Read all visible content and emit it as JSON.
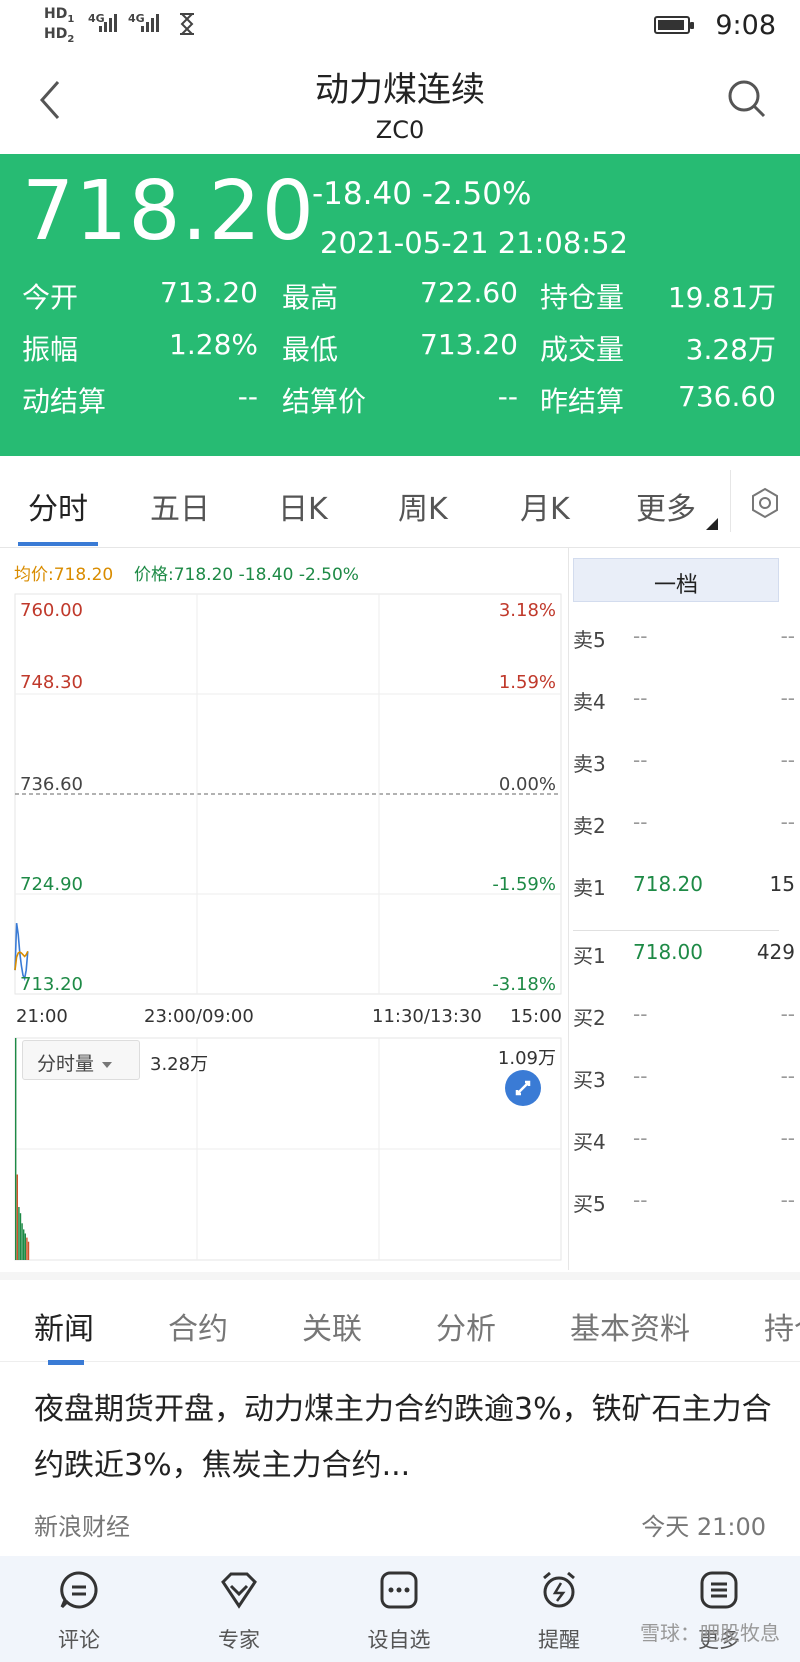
{
  "status_bar": {
    "net1": "HD",
    "net1_sub": "1",
    "net2": "HD",
    "net2_sub": "2",
    "sig1": "4G",
    "sig2": "4G",
    "time": "9:08"
  },
  "header": {
    "title": "动力煤连续",
    "code": "ZC0",
    "back_icon": "chevron-left-icon",
    "search_icon": "search-icon"
  },
  "quote": {
    "bg_color": "#27bb73",
    "price": "718.20",
    "change": "-18.40 -2.50%",
    "datetime": "2021-05-21 21:08:52",
    "fields": [
      {
        "label": "今开",
        "value": "713.20"
      },
      {
        "label": "最高",
        "value": "722.60"
      },
      {
        "label": "持仓量",
        "value": "19.81万"
      },
      {
        "label": "振幅",
        "value": "1.28%"
      },
      {
        "label": "最低",
        "value": "713.20"
      },
      {
        "label": "成交量",
        "value": "3.28万"
      },
      {
        "label": "动结算",
        "value": "--"
      },
      {
        "label": "结算价",
        "value": "--"
      },
      {
        "label": "昨结算",
        "value": "736.60"
      }
    ]
  },
  "chart_tabs": {
    "items": [
      "分时",
      "五日",
      "日K",
      "周K",
      "月K",
      "更多"
    ],
    "active": "分时",
    "settings_icon": "hexagon-settings-icon"
  },
  "chart": {
    "legend_avg": "均价:718.20",
    "legend_price": "价格:718.20 -18.40 -2.50%",
    "avg_color": "#d98c00",
    "price_color": "#1e8a46",
    "y_labels": [
      "760.00",
      "748.30",
      "736.60",
      "724.90",
      "713.20"
    ],
    "pct_labels": [
      "3.18%",
      "1.59%",
      "0.00%",
      "-1.59%",
      "-3.18%"
    ],
    "x_labels": [
      "21:00",
      "23:00/09:00",
      "11:30/13:30",
      "15:00"
    ],
    "volume_button": "分时量",
    "volume_total": "3.28万",
    "volume_max": "1.09万",
    "expand_icon": "expand-icon"
  },
  "chart_data": {
    "type": "line",
    "title": "",
    "x": [
      "21:00",
      "21:01",
      "21:02",
      "21:03",
      "21:04",
      "21:05",
      "21:06",
      "21:07",
      "21:08"
    ],
    "series": [
      {
        "name": "价格",
        "values": [
          716.0,
          721.5,
          720.2,
          718.0,
          716.5,
          715.4,
          715.0,
          716.0,
          718.2
        ]
      },
      {
        "name": "均价",
        "values": [
          716.0,
          717.5,
          718.0,
          718.1,
          718.0,
          717.8,
          717.6,
          717.8,
          718.2
        ]
      }
    ],
    "volume": [
      10900,
      4200,
      2600,
      2300,
      1800,
      1500,
      1300,
      1100,
      900
    ],
    "ylim": [
      713.2,
      760.0
    ],
    "volume_max": 10900,
    "xlabel": "",
    "ylabel": ""
  },
  "order_book": {
    "header": "一档",
    "sell": [
      {
        "label": "卖5",
        "price": "--",
        "vol": "--"
      },
      {
        "label": "卖4",
        "price": "--",
        "vol": "--"
      },
      {
        "label": "卖3",
        "price": "--",
        "vol": "--"
      },
      {
        "label": "卖2",
        "price": "--",
        "vol": "--"
      },
      {
        "label": "卖1",
        "price": "718.20",
        "vol": "15"
      }
    ],
    "buy": [
      {
        "label": "买1",
        "price": "718.00",
        "vol": "429"
      },
      {
        "label": "买2",
        "price": "--",
        "vol": "--"
      },
      {
        "label": "买3",
        "price": "--",
        "vol": "--"
      },
      {
        "label": "买4",
        "price": "--",
        "vol": "--"
      },
      {
        "label": "买5",
        "price": "--",
        "vol": "--"
      }
    ]
  },
  "news_tabs": {
    "items": [
      "新闻",
      "合约",
      "关联",
      "分析",
      "基本资料",
      "持仓"
    ],
    "active": "新闻"
  },
  "news": {
    "headline": "夜盘期货开盘，动力煤主力合约跌逾3%，铁矿石主力合约跌近3%，焦炭主力合约...",
    "source": "新浪财经",
    "time": "今天 21:00"
  },
  "bottom_nav": {
    "items": [
      {
        "label": "评论",
        "icon": "comment-icon"
      },
      {
        "label": "专家",
        "icon": "diamond-icon"
      },
      {
        "label": "设自选",
        "icon": "more-dots-icon"
      },
      {
        "label": "提醒",
        "icon": "alarm-clock-icon"
      },
      {
        "label": "更多",
        "icon": "menu-icon"
      }
    ]
  },
  "watermark": "雪球：吧股牧息"
}
